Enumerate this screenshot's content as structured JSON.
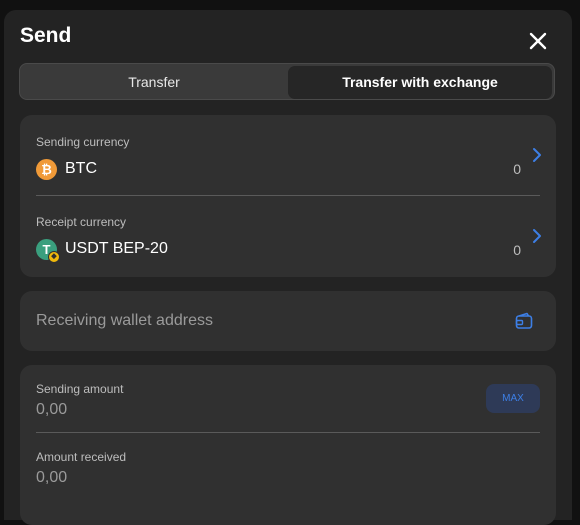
{
  "modal": {
    "title": "Send"
  },
  "tabs": [
    {
      "label": "Transfer",
      "active": false
    },
    {
      "label": "Transfer with exchange",
      "active": true
    }
  ],
  "sending": {
    "label": "Sending currency",
    "currency": "BTC",
    "balance": "0",
    "icon": "bitcoin-icon"
  },
  "receipt": {
    "label": "Receipt currency",
    "currency": "USDT BEP-20",
    "balance": "0",
    "icon": "tether-icon"
  },
  "address": {
    "placeholder": "Receiving wallet address",
    "value": "",
    "icon": "wallet-icon"
  },
  "amounts": {
    "sending_label": "Sending amount",
    "sending_value": "0,00",
    "max_label": "MAX",
    "received_label": "Amount received",
    "received_value": "0,00"
  },
  "colors": {
    "accent": "#3d7fe6",
    "btc": "#f09a38",
    "usdt": "#3a9f7e"
  }
}
